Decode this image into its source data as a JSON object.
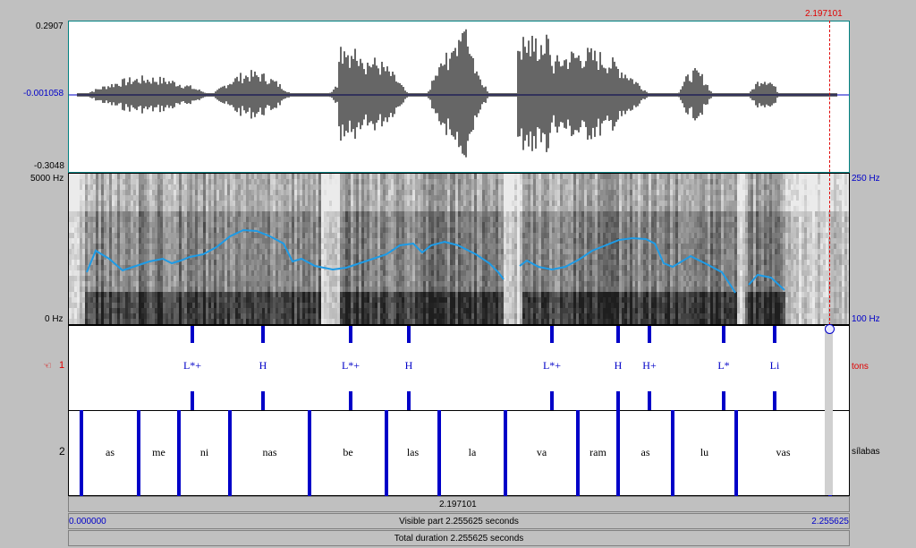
{
  "waveform": {
    "max_label": "0.2907",
    "mid_label": "-0.001058",
    "min_label": "-0.3048"
  },
  "spectrogram": {
    "freq_top": "5000 Hz",
    "freq_bottom": "0 Hz",
    "pitch_top": "250 Hz",
    "pitch_bottom": "100 Hz"
  },
  "cursor": {
    "time_label": "2.197101"
  },
  "tiers": [
    {
      "number": "1",
      "name": "tons",
      "labels": [
        "L*+",
        "H",
        "L*+",
        "H",
        "L*+",
        "H",
        "H+",
        "L*",
        "Li"
      ]
    },
    {
      "number": "2",
      "name": "sílabas",
      "labels": [
        "as",
        "me",
        "ni",
        "nas",
        "be",
        "las",
        "la",
        "va",
        "ram",
        "as",
        "lu",
        "vas"
      ]
    }
  ],
  "timeline": {
    "cursor_time": "2.197101",
    "start": "0.000000",
    "visible": "Visible part 2.255625 seconds",
    "end": "2.255625",
    "total": "Total duration 2.255625 seconds"
  },
  "colors": {
    "boundary": "#0000c8",
    "pitch": "#1e9be6",
    "cursor": "#e00000"
  }
}
